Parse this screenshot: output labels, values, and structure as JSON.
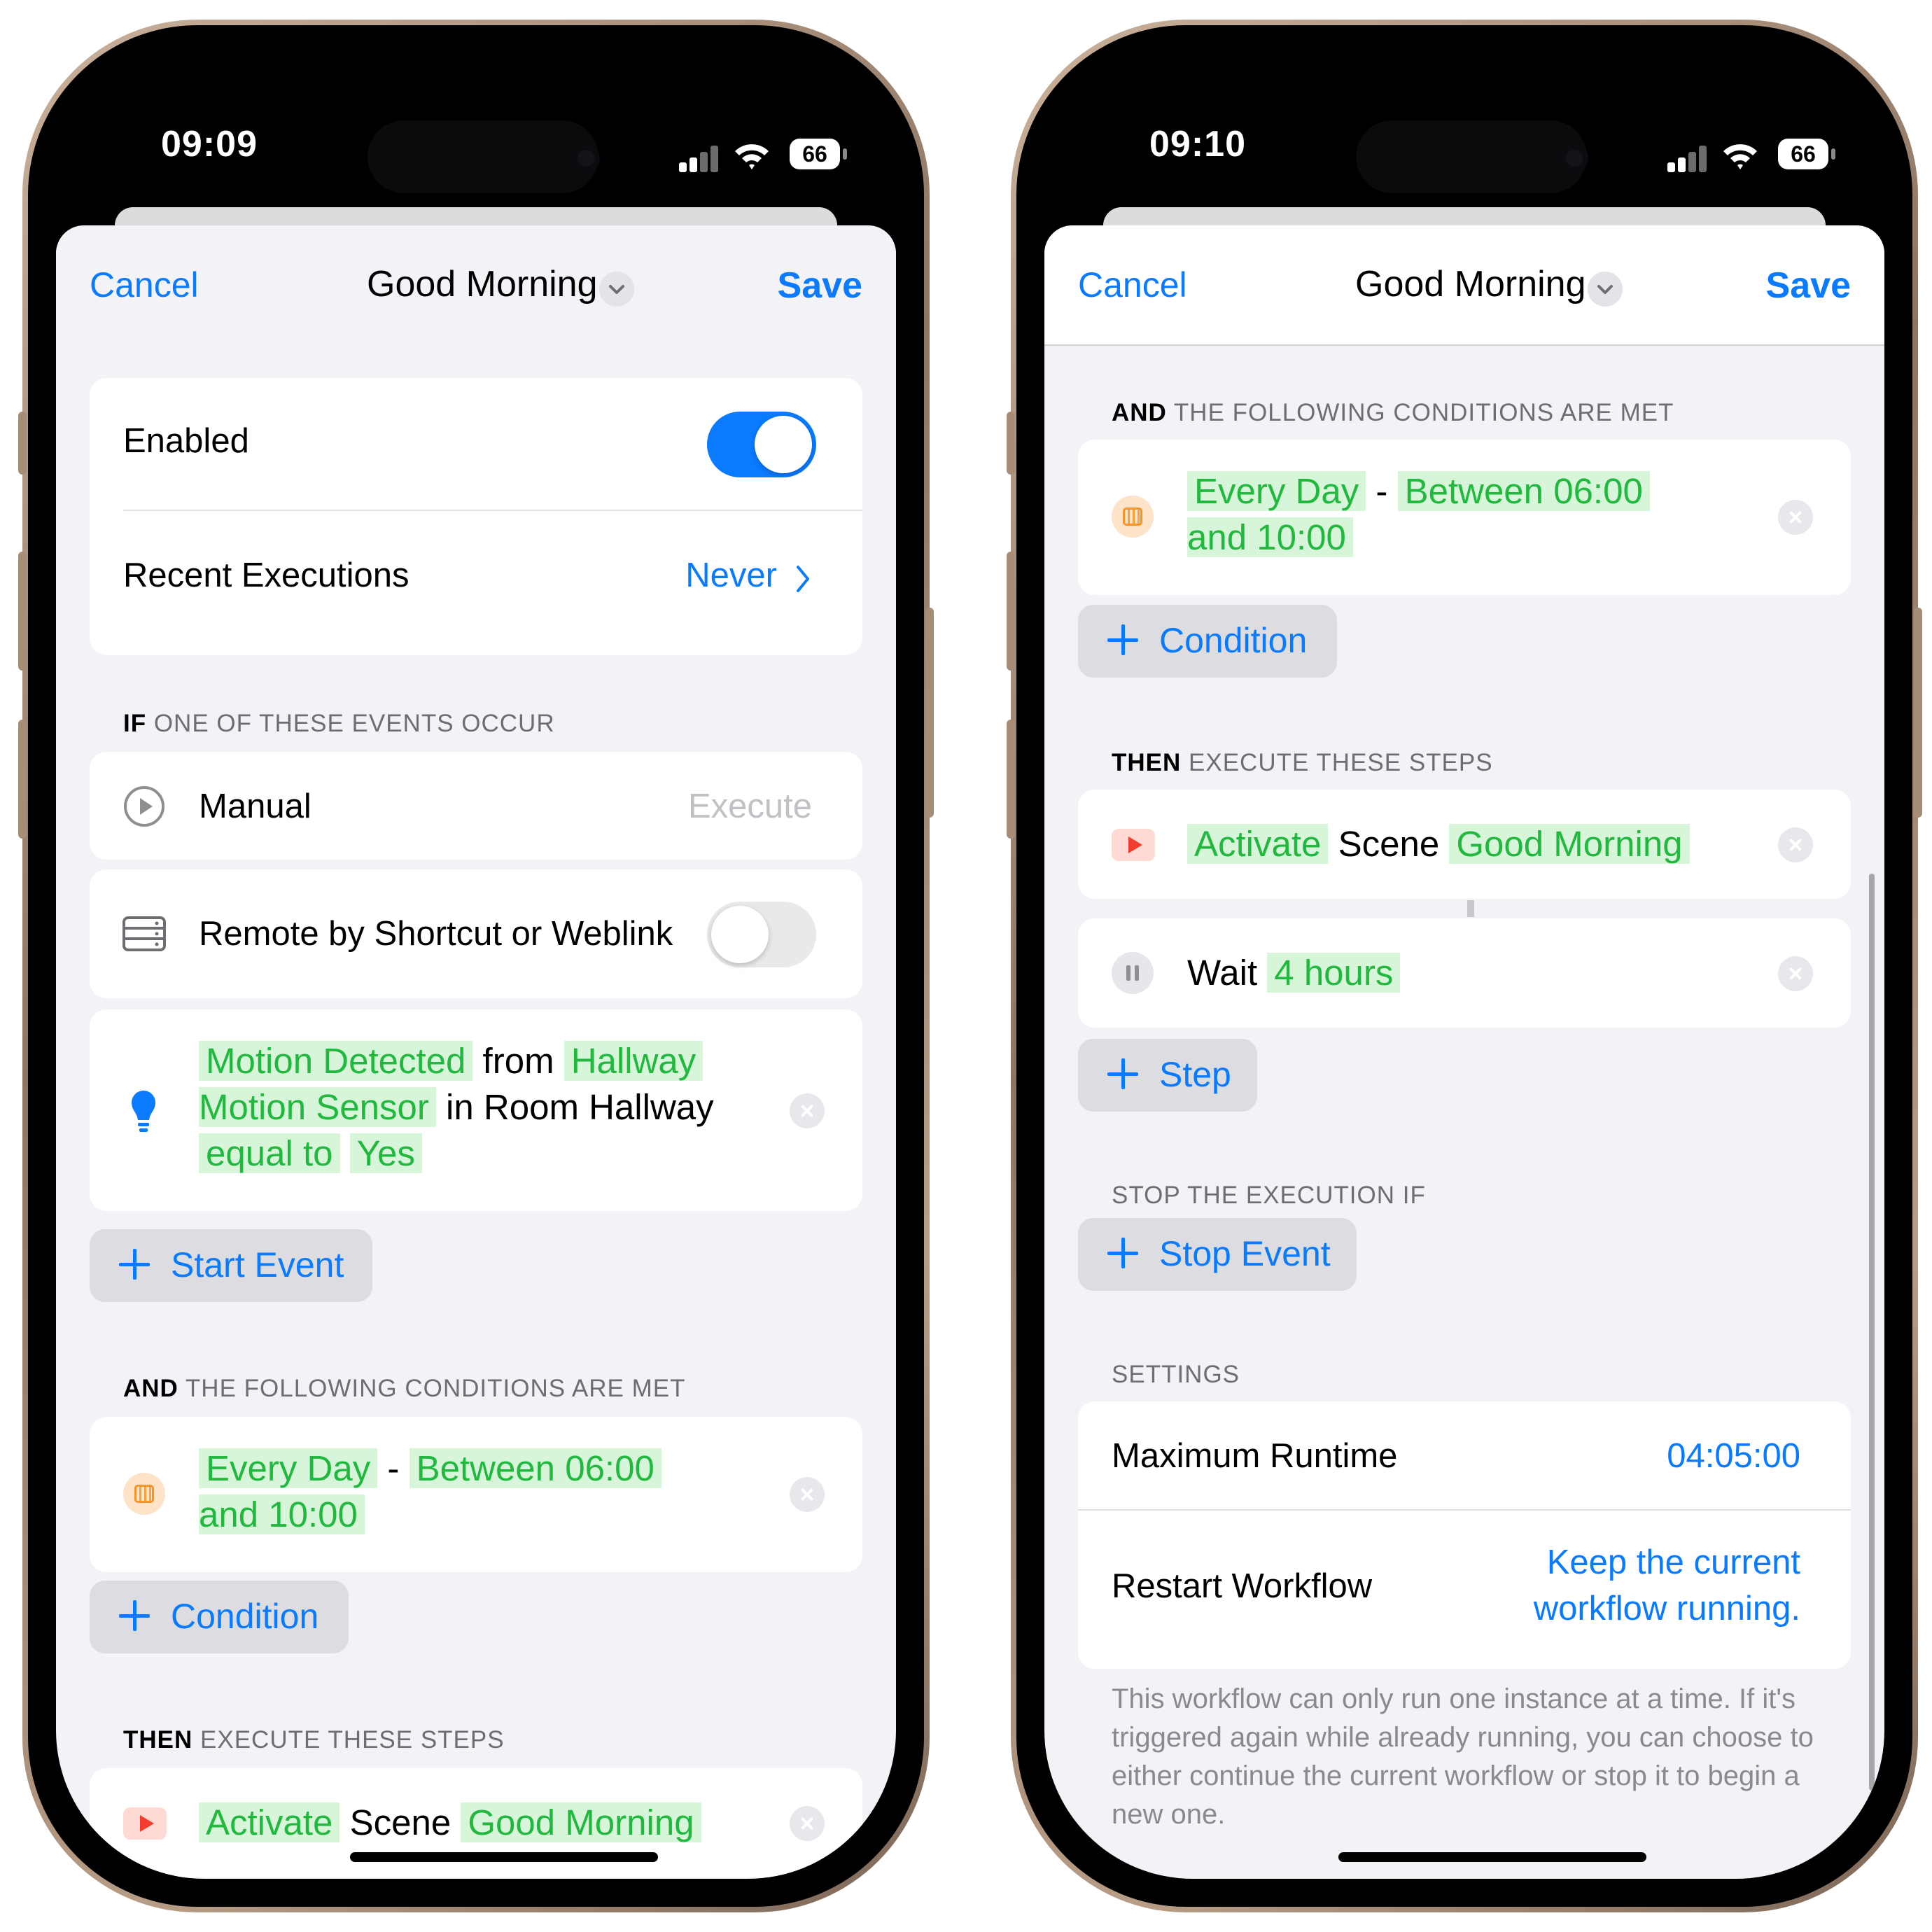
{
  "left": {
    "status": {
      "time": "09:09",
      "battery": "66"
    },
    "nav": {
      "cancel": "Cancel",
      "title": "Good Morning",
      "save": "Save"
    },
    "enabled": {
      "label": "Enabled",
      "on": true
    },
    "recent": {
      "label": "Recent Executions",
      "value": "Never"
    },
    "events_header": {
      "bold": "IF",
      "rest": " ONE OF THESE EVENTS OCCUR"
    },
    "manual": {
      "label": "Manual",
      "action": "Execute"
    },
    "remote": {
      "label": "Remote by Shortcut or Weblink",
      "on": false
    },
    "motion": {
      "event": "Motion Detected",
      "from": "from",
      "device_1": "Hallway",
      "device_2": "Motion Sensor",
      "room": "in Room Hallway",
      "comparator": "equal to",
      "value": "Yes"
    },
    "add_start_event": "Start Event",
    "conditions_header": {
      "bold": "AND",
      "rest": " THE FOLLOWING CONDITIONS ARE MET"
    },
    "condition": {
      "days": "Every Day",
      "dash": "-",
      "range_1": "Between 06:00",
      "range_2": "and 10:00"
    },
    "add_condition": "Condition",
    "steps_header": {
      "bold": "THEN",
      "rest": " EXECUTE THESE STEPS"
    },
    "step_1": {
      "verb": "Activate",
      "noun": "Scene",
      "target": "Good Morning"
    }
  },
  "right": {
    "status": {
      "time": "09:10",
      "battery": "66"
    },
    "nav": {
      "cancel": "Cancel",
      "title": "Good Morning",
      "save": "Save"
    },
    "conditions_header": {
      "bold": "AND",
      "rest": " THE FOLLOWING CONDITIONS ARE MET"
    },
    "condition": {
      "days": "Every Day",
      "dash": "-",
      "range_1": "Between 06:00",
      "range_2": "and 10:00"
    },
    "add_condition": "Condition",
    "steps_header": {
      "bold": "THEN",
      "rest": " EXECUTE THESE STEPS"
    },
    "step_1": {
      "verb": "Activate",
      "noun": "Scene",
      "target": "Good Morning"
    },
    "step_2": {
      "verb": "Wait",
      "duration": "4 hours"
    },
    "add_step": "Step",
    "stop_header": "STOP THE EXECUTION IF",
    "add_stop_event": "Stop Event",
    "settings_header": "SETTINGS",
    "max_runtime": {
      "label": "Maximum Runtime",
      "value": "04:05:00"
    },
    "restart": {
      "label": "Restart Workflow",
      "value_1": "Keep the current",
      "value_2": "workflow running."
    },
    "footer": "This workflow can only run one instance at a time. If it's triggered again while already running, you can choose to either continue the current workflow or stop it to begin a new one."
  },
  "colors": {
    "accent": "#0a7aff",
    "highlight_bg": "#d6f5d9",
    "highlight_text": "#22b83f",
    "toggle_on": "#0a7aff"
  },
  "icons": [
    "cellular-signal-icon",
    "wifi-icon",
    "battery-icon",
    "chevron-down-icon",
    "chevron-right-icon",
    "play-circle-icon",
    "remote-server-icon",
    "lightbulb-icon",
    "calendar-icon",
    "scene-play-icon",
    "pause-icon",
    "plus-icon",
    "clear-icon"
  ]
}
